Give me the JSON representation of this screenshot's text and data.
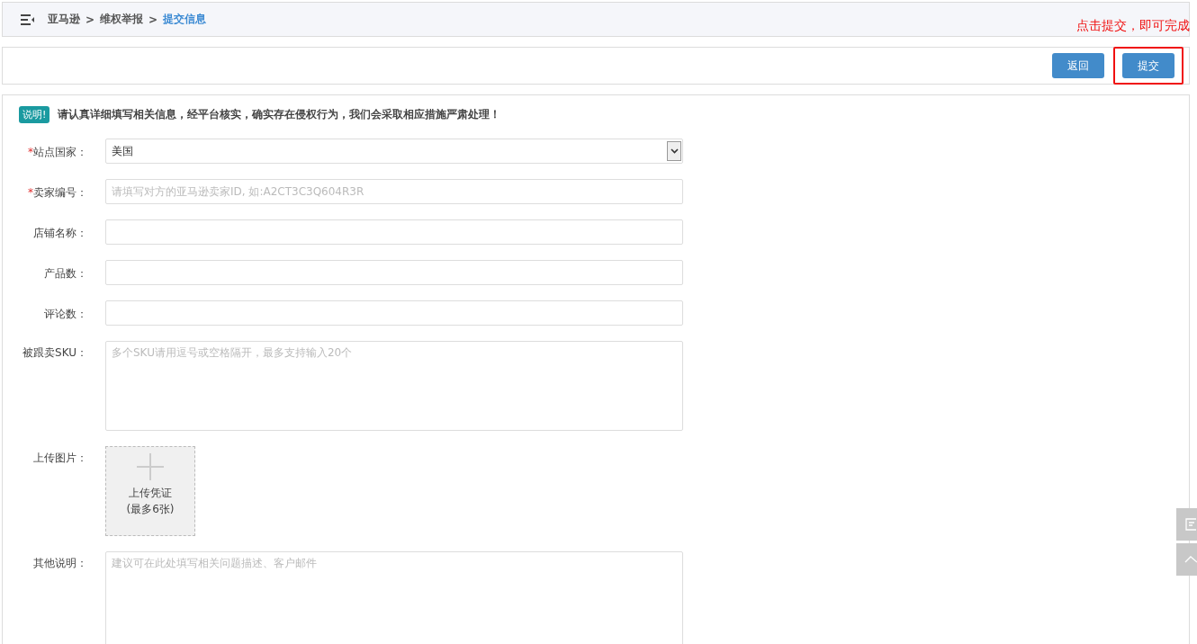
{
  "breadcrumb": [
    {
      "label": "亚马逊",
      "current": false
    },
    {
      "label": "维权举报",
      "current": false
    },
    {
      "label": "提交信息",
      "current": true
    }
  ],
  "breadcrumb_separator": ">",
  "required_marker": "*",
  "annotation": {
    "text": "点击提交，即可完成"
  },
  "toolbar": {
    "buttons": [
      {
        "label": "返回",
        "highlighted": false
      },
      {
        "label": "提交",
        "highlighted": true
      }
    ]
  },
  "notice": {
    "badge": "说明!",
    "text": "请认真详细填写相关信息，经平台核实，确实存在侵权行为，我们会采取相应措施严肃处理！"
  },
  "fields": [
    {
      "kind": "select",
      "label": "站点国家：",
      "required": true,
      "value": "美国"
    },
    {
      "kind": "input",
      "label": "卖家编号：",
      "required": true,
      "placeholder": "请填写对方的亚马逊卖家ID, 如:A2CT3C3Q604R3R"
    },
    {
      "kind": "input",
      "label": "店铺名称：",
      "required": false
    },
    {
      "kind": "input",
      "label": "产品数：",
      "required": false
    },
    {
      "kind": "input",
      "label": "评论数：",
      "required": false
    },
    {
      "kind": "textarea",
      "label": "被跟卖SKU：",
      "required": false,
      "placeholder": "多个SKU请用逗号或空格隔开，最多支持输入20个",
      "tall": false
    },
    {
      "kind": "upload",
      "label": "上传图片：",
      "required": false,
      "caption": "上传凭证",
      "note": "(最多6张)"
    },
    {
      "kind": "textarea",
      "label": "其他说明：",
      "required": false,
      "placeholder": "建议可在此处填写相关问题描述、客户邮件",
      "tall": true
    }
  ]
}
